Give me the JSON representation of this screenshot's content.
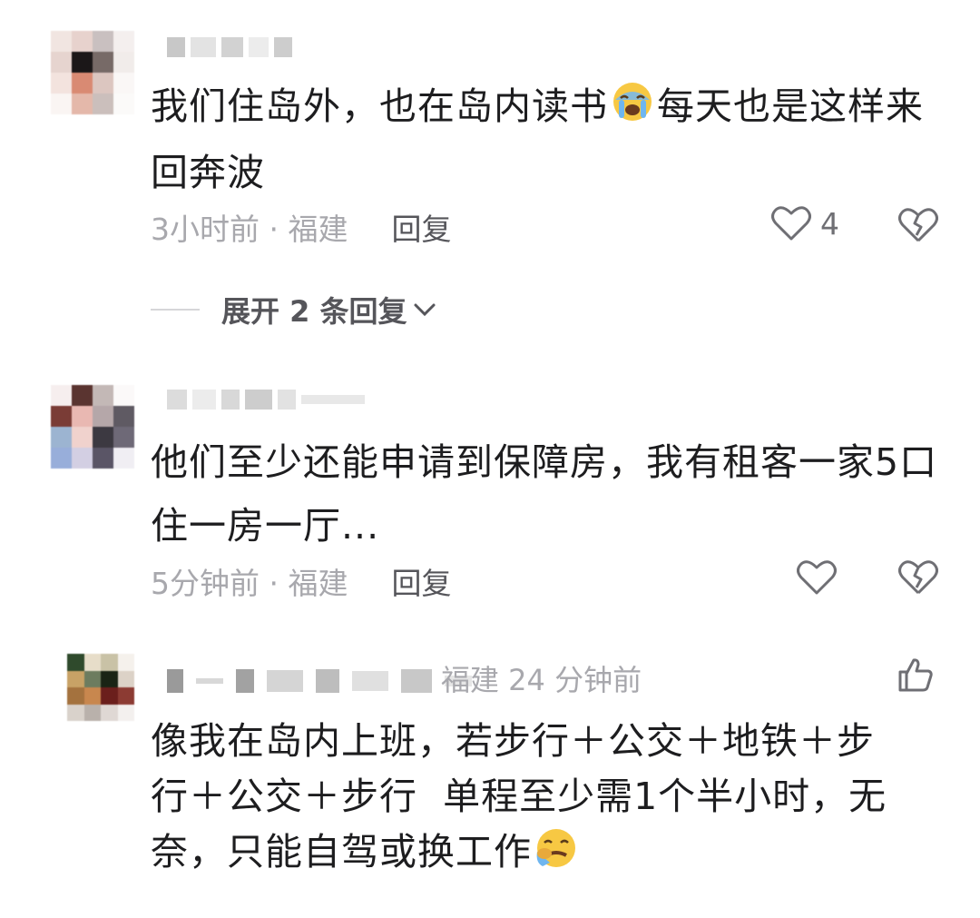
{
  "comments": [
    {
      "text_part1": "我们住岛外，也在岛内读书",
      "emoji": "loudly-crying-face-emoji",
      "text_part2": "每天也是这样来\n回奔波",
      "time_location": "3小时前 · 福建",
      "reply_label": "回复",
      "like_count": "4"
    },
    {
      "text": "他们至少还能申请到保障房，我有租客一家5口\n住一房一厅...",
      "time_location": "5分钟前 · 福建",
      "reply_label": "回复"
    },
    {
      "location_time": "福建 24 分钟前",
      "text": "像我在岛内上班，若步行＋公交＋地铁＋步\n行＋公交＋步行  单程至少需1个半小时，无\n奈，只能自驾或换工作",
      "emoji": "crying-face-emoji"
    }
  ],
  "expand_replies": {
    "label": "展开 2 条回复"
  },
  "colors": {
    "text_primary": "#1d1d1f",
    "text_secondary": "#a8a8ad",
    "reply": "#55555a"
  }
}
